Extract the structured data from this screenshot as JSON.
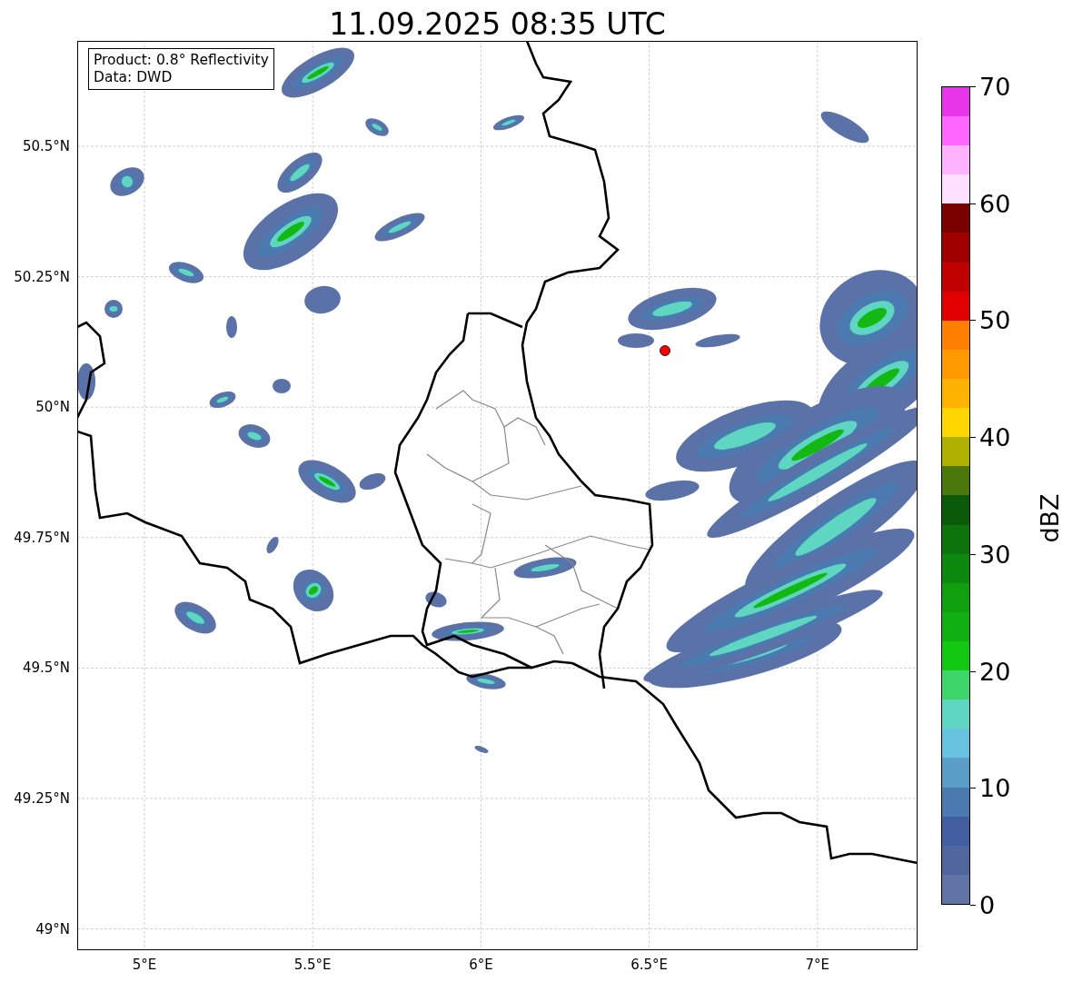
{
  "title": "11.09.2025 08:35 UTC",
  "info_box": {
    "lines": [
      "Product: 0.8° Reflectivity",
      "Data: DWD"
    ]
  },
  "map": {
    "lat_ticks": [
      "50.5°N",
      "50.25°N",
      "50°N",
      "49.75°N",
      "49.5°N",
      "49.25°N",
      "49°N"
    ],
    "lon_ticks": [
      "5°E",
      "5.5°E",
      "6°E",
      "6.5°E",
      "7°E"
    ]
  },
  "colorbar": {
    "label": "dBZ",
    "ticks": [
      "70",
      "60",
      "50",
      "40",
      "30",
      "20",
      "10",
      "0"
    ],
    "segments": [
      {
        "color": "#6274a6"
      },
      {
        "color": "#51669d"
      },
      {
        "color": "#435ea0"
      },
      {
        "color": "#4a7ab0"
      },
      {
        "color": "#5a9ec8"
      },
      {
        "color": "#66c2de"
      },
      {
        "color": "#5fd6c2"
      },
      {
        "color": "#3dd66b"
      },
      {
        "color": "#13c813"
      },
      {
        "color": "#10b010"
      },
      {
        "color": "#0f9f0f"
      },
      {
        "color": "#0d8a0d"
      },
      {
        "color": "#0b740b"
      },
      {
        "color": "#0a5a0a"
      },
      {
        "color": "#4a780a"
      },
      {
        "color": "#b0b000"
      },
      {
        "color": "#ffd700"
      },
      {
        "color": "#ffb300"
      },
      {
        "color": "#ff9900"
      },
      {
        "color": "#ff7f00"
      },
      {
        "color": "#e00000"
      },
      {
        "color": "#c00000"
      },
      {
        "color": "#a00000"
      },
      {
        "color": "#7a0000"
      },
      {
        "color": "#ffe0ff"
      },
      {
        "color": "#ffb3ff"
      },
      {
        "color": "#ff66ff"
      },
      {
        "color": "#e935e9"
      }
    ]
  }
}
